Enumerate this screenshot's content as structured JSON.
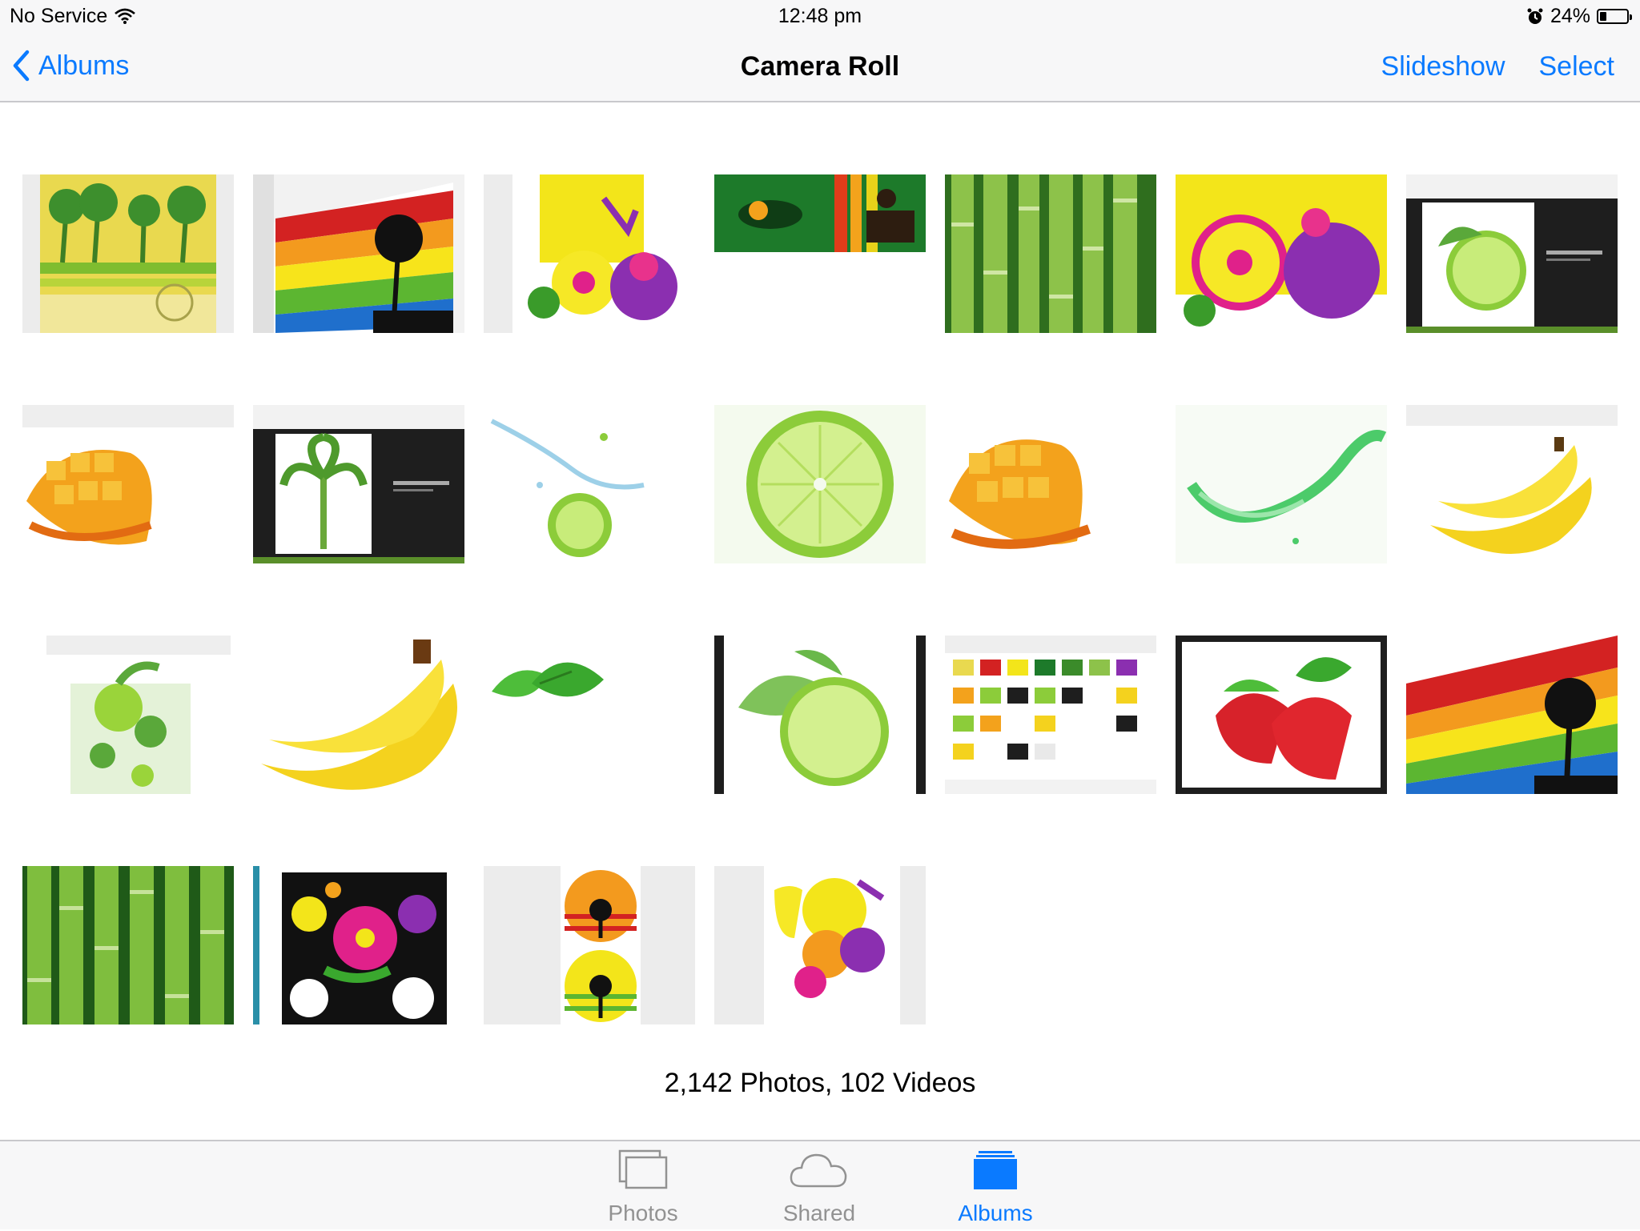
{
  "status_bar": {
    "carrier": "No Service",
    "time": "12:48 pm",
    "battery_percent": "24%",
    "battery_level": 0.24
  },
  "nav": {
    "back_label": "Albums",
    "title": "Camera Roll",
    "slideshow_label": "Slideshow",
    "select_label": "Select"
  },
  "grid": {
    "photo_count_text": "2,142 Photos, 102 Videos"
  },
  "tabs": [
    {
      "label": "Photos",
      "icon": "photos-icon",
      "active": false
    },
    {
      "label": "Shared",
      "icon": "cloud-icon",
      "active": false
    },
    {
      "label": "Albums",
      "icon": "albums-icon",
      "active": true
    }
  ],
  "colors": {
    "tint": "#0a7aff",
    "inactive_tab": "#929292",
    "bar_background": "#f7f7f8"
  }
}
